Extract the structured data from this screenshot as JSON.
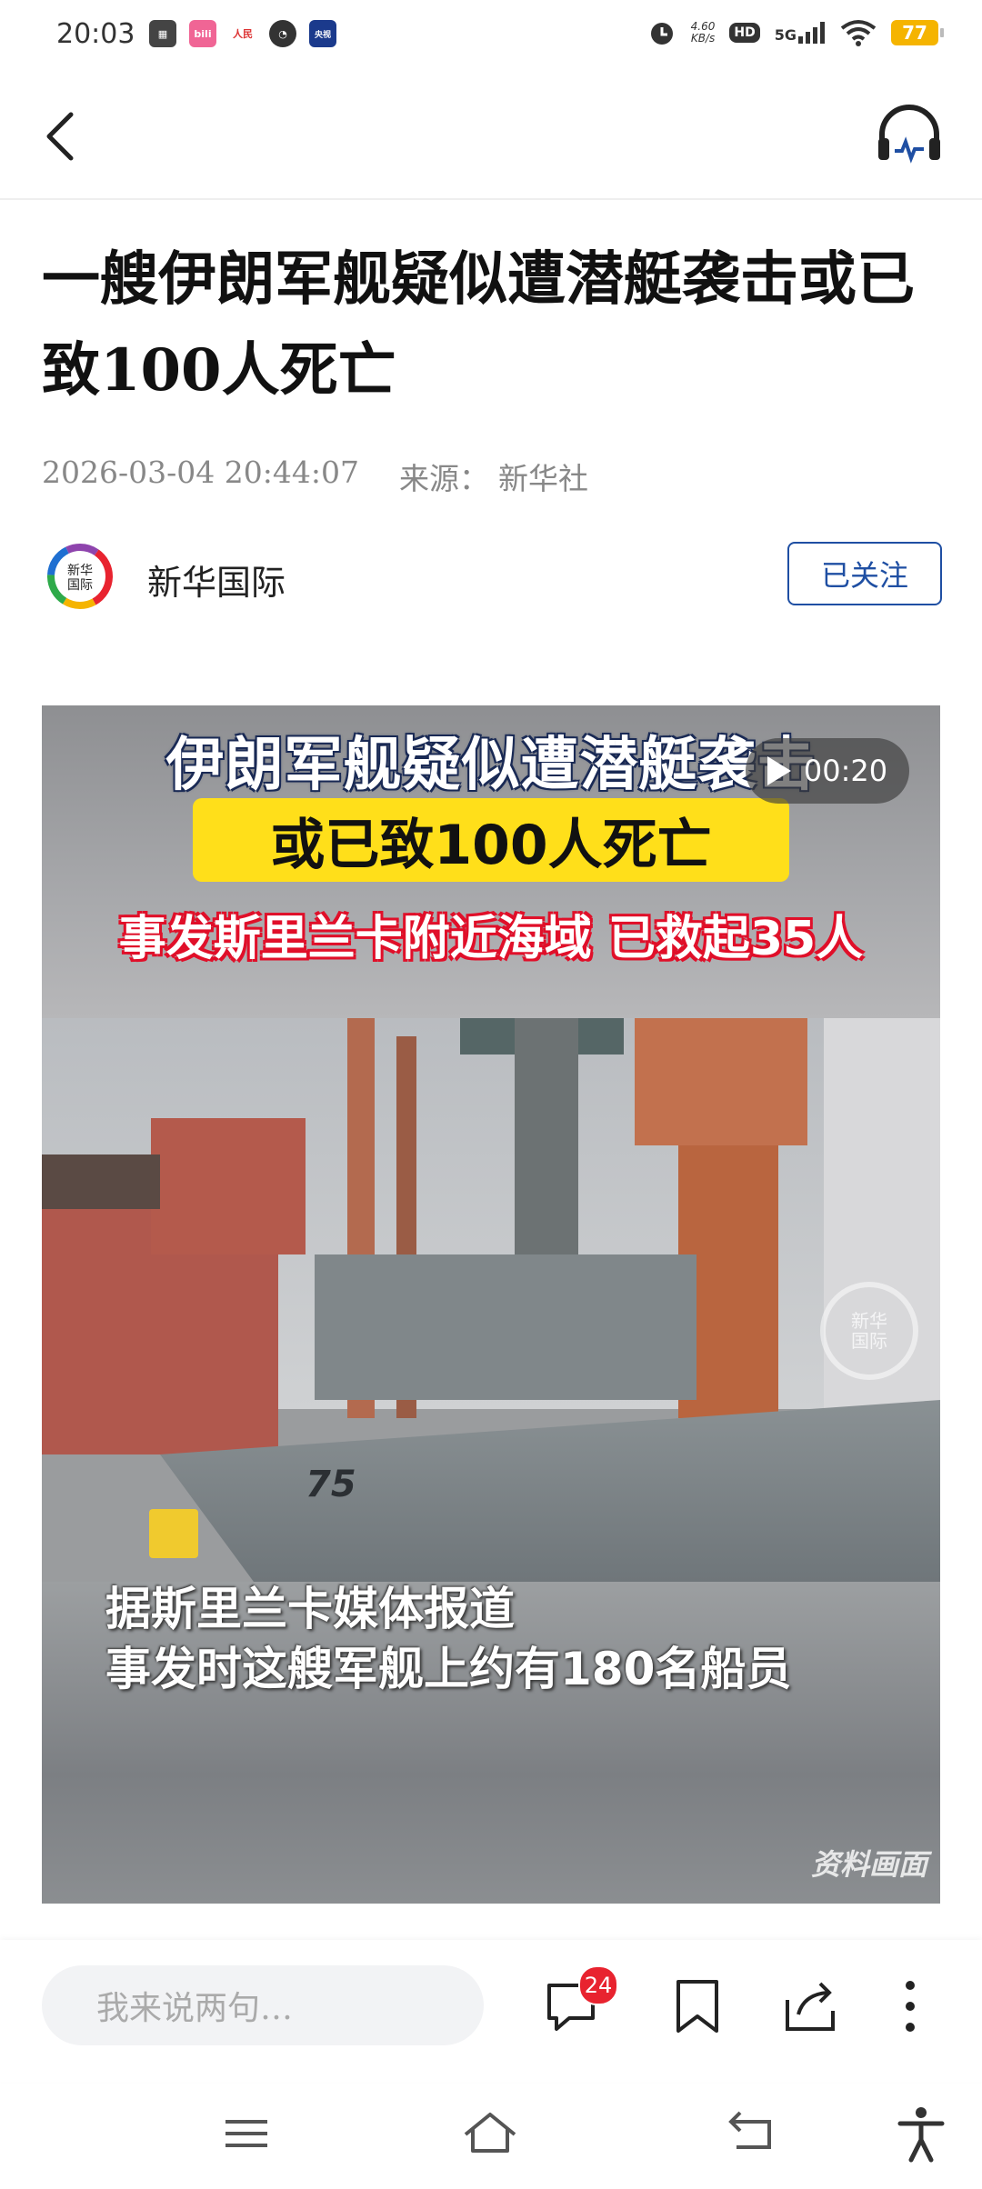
{
  "status_bar": {
    "time": "20:03",
    "speed_value": "4.60",
    "speed_unit": "KB/s",
    "hd": "HD",
    "network": "5G",
    "battery": "77",
    "app_icons": [
      "photos-icon",
      "bilibili-icon",
      "people-daily-icon",
      "alarm-icon",
      "cctv-news-icon"
    ]
  },
  "nav": {
    "back_icon": "chevron-left-icon",
    "listen_icon": "headphones-icon"
  },
  "article": {
    "title": "一艘伊朗军舰疑似遭潜艇袭击或已致100人死亡",
    "datetime": "2026-03-04 20:44:07",
    "source_label": "来源：",
    "source_value": "新华社"
  },
  "author": {
    "name": "新华国际",
    "logo_text": "新华\n国际",
    "follow_label": "已关注"
  },
  "video": {
    "caption_line1": "伊朗军舰疑似遭潜艇袭击",
    "caption_line2": "或已致100人死亡",
    "caption_line3": "事发斯里兰卡附近海域 已救起35人",
    "duration": "00:20",
    "hull_number": "75",
    "watermark": "新华\n国际",
    "subtitle_line1": "据斯里兰卡媒体报道",
    "subtitle_line2": "事发时这艘军舰上约有180名船员",
    "archive_label": "资料画面"
  },
  "bottom_bar": {
    "comment_placeholder": "我来说两句…",
    "comment_count": "24",
    "icons": [
      "comment-icon",
      "bookmark-icon",
      "share-icon",
      "more-icon"
    ]
  },
  "system_nav": {
    "icons": [
      "menu-icon",
      "home-icon",
      "back-icon",
      "accessibility-icon"
    ]
  },
  "colors": {
    "accent_blue": "#1f4fa3",
    "badge_red": "#e8232f",
    "caption_yellow": "#ffdf1a",
    "battery": "#f5b400"
  }
}
